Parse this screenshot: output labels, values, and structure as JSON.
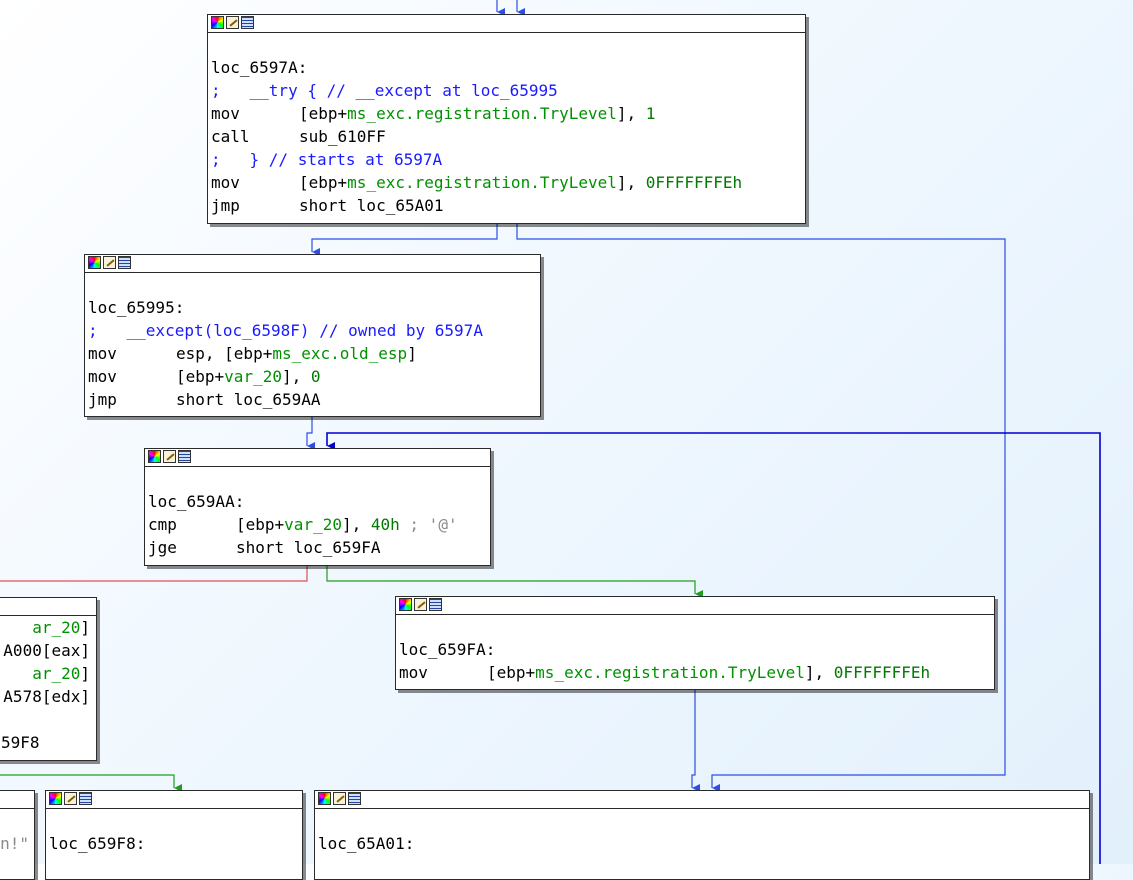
{
  "colors": {
    "edge_normal": "#2b4ee8",
    "edge_true": "#1f9d1f",
    "edge_false": "#e05050",
    "edge_back": "#0000d0",
    "comment": "#1a1aff",
    "variable": "#009100"
  },
  "header_icons": [
    "graph-icon",
    "pencil-icon",
    "list-icon"
  ],
  "nodes": {
    "n1": {
      "label": "loc_6597A:",
      "l1_cmt": ";   __try { // __except at loc_65995",
      "l2_mn": "mov",
      "l2_a": "[ebp+",
      "l2_b": "ms_exc.registration.TryLevel",
      "l2_c": "], ",
      "l2_d": "1",
      "l3_mn": "call",
      "l3_a": "sub_610FF",
      "l4_cmt": ";   } // starts at 6597A",
      "l5_mn": "mov",
      "l5_a": "[ebp+",
      "l5_b": "ms_exc.registration.TryLevel",
      "l5_c": "], ",
      "l5_d": "0FFFFFFFEh",
      "l6_mn": "jmp",
      "l6_a": "short loc_65A01"
    },
    "n2": {
      "label": "loc_65995:",
      "l1_cmt": ";   __except(loc_6598F) // owned by 6597A",
      "l2_mn": "mov",
      "l2_a": "esp, [ebp+",
      "l2_b": "ms_exc.old_esp",
      "l2_c": "]",
      "l3_mn": "mov",
      "l3_a": "[ebp+",
      "l3_b": "var_20",
      "l3_c": "], ",
      "l3_d": "0",
      "l4_mn": "jmp",
      "l4_a": "short loc_659AA"
    },
    "n3": {
      "label": "loc_659AA:",
      "l1_mn": "cmp",
      "l1_a": "[ebp+",
      "l1_b": "var_20",
      "l1_c": "], ",
      "l1_d": "40h",
      "l1_e": " ; '@'",
      "l2_mn": "jge",
      "l2_a": "short loc_659FA"
    },
    "n4": {
      "label": "loc_659FA:",
      "l1_mn": "mov",
      "l1_a": "[ebp+",
      "l1_b": "ms_exc.registration.TryLevel",
      "l1_c": "], ",
      "l1_d": "0FFFFFFFEh"
    },
    "n5": {
      "l1_a": "ar_20",
      "l1_b": "]",
      "l2_a": "A000[eax]",
      "l3_a": "ar_20",
      "l3_b": "]",
      "l4_a": "A578[edx]",
      "l6_a": "59F8"
    },
    "n6": {
      "l2_a": "n!\""
    },
    "n7": {
      "label": "loc_659F8:"
    },
    "n8": {
      "label": "loc_65A01:"
    }
  }
}
